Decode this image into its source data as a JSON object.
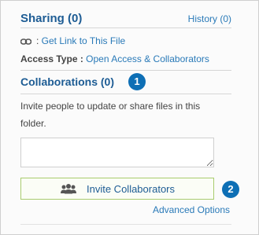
{
  "sharing": {
    "title": "Sharing (0)",
    "history_link": "History (0)",
    "get_link": "Get Link to This File",
    "access_type_label": "Access Type :",
    "access_type_value": "Open Access & Collaborators"
  },
  "collaborations": {
    "title": "Collaborations (0)",
    "badge": "1",
    "description": "Invite people to update or share files in this folder.",
    "input_value": "",
    "invite_button": "Invite Collaborators",
    "button_badge": "2",
    "advanced_link": "Advanced Options"
  },
  "colors": {
    "title_blue": "#1d5c94",
    "link_blue": "#2a7ab8",
    "badge_blue": "#0e6fb5",
    "button_border_green": "#a9cc6e"
  },
  "icons": {
    "link": "chain-link-icon",
    "people": "people-icon"
  }
}
